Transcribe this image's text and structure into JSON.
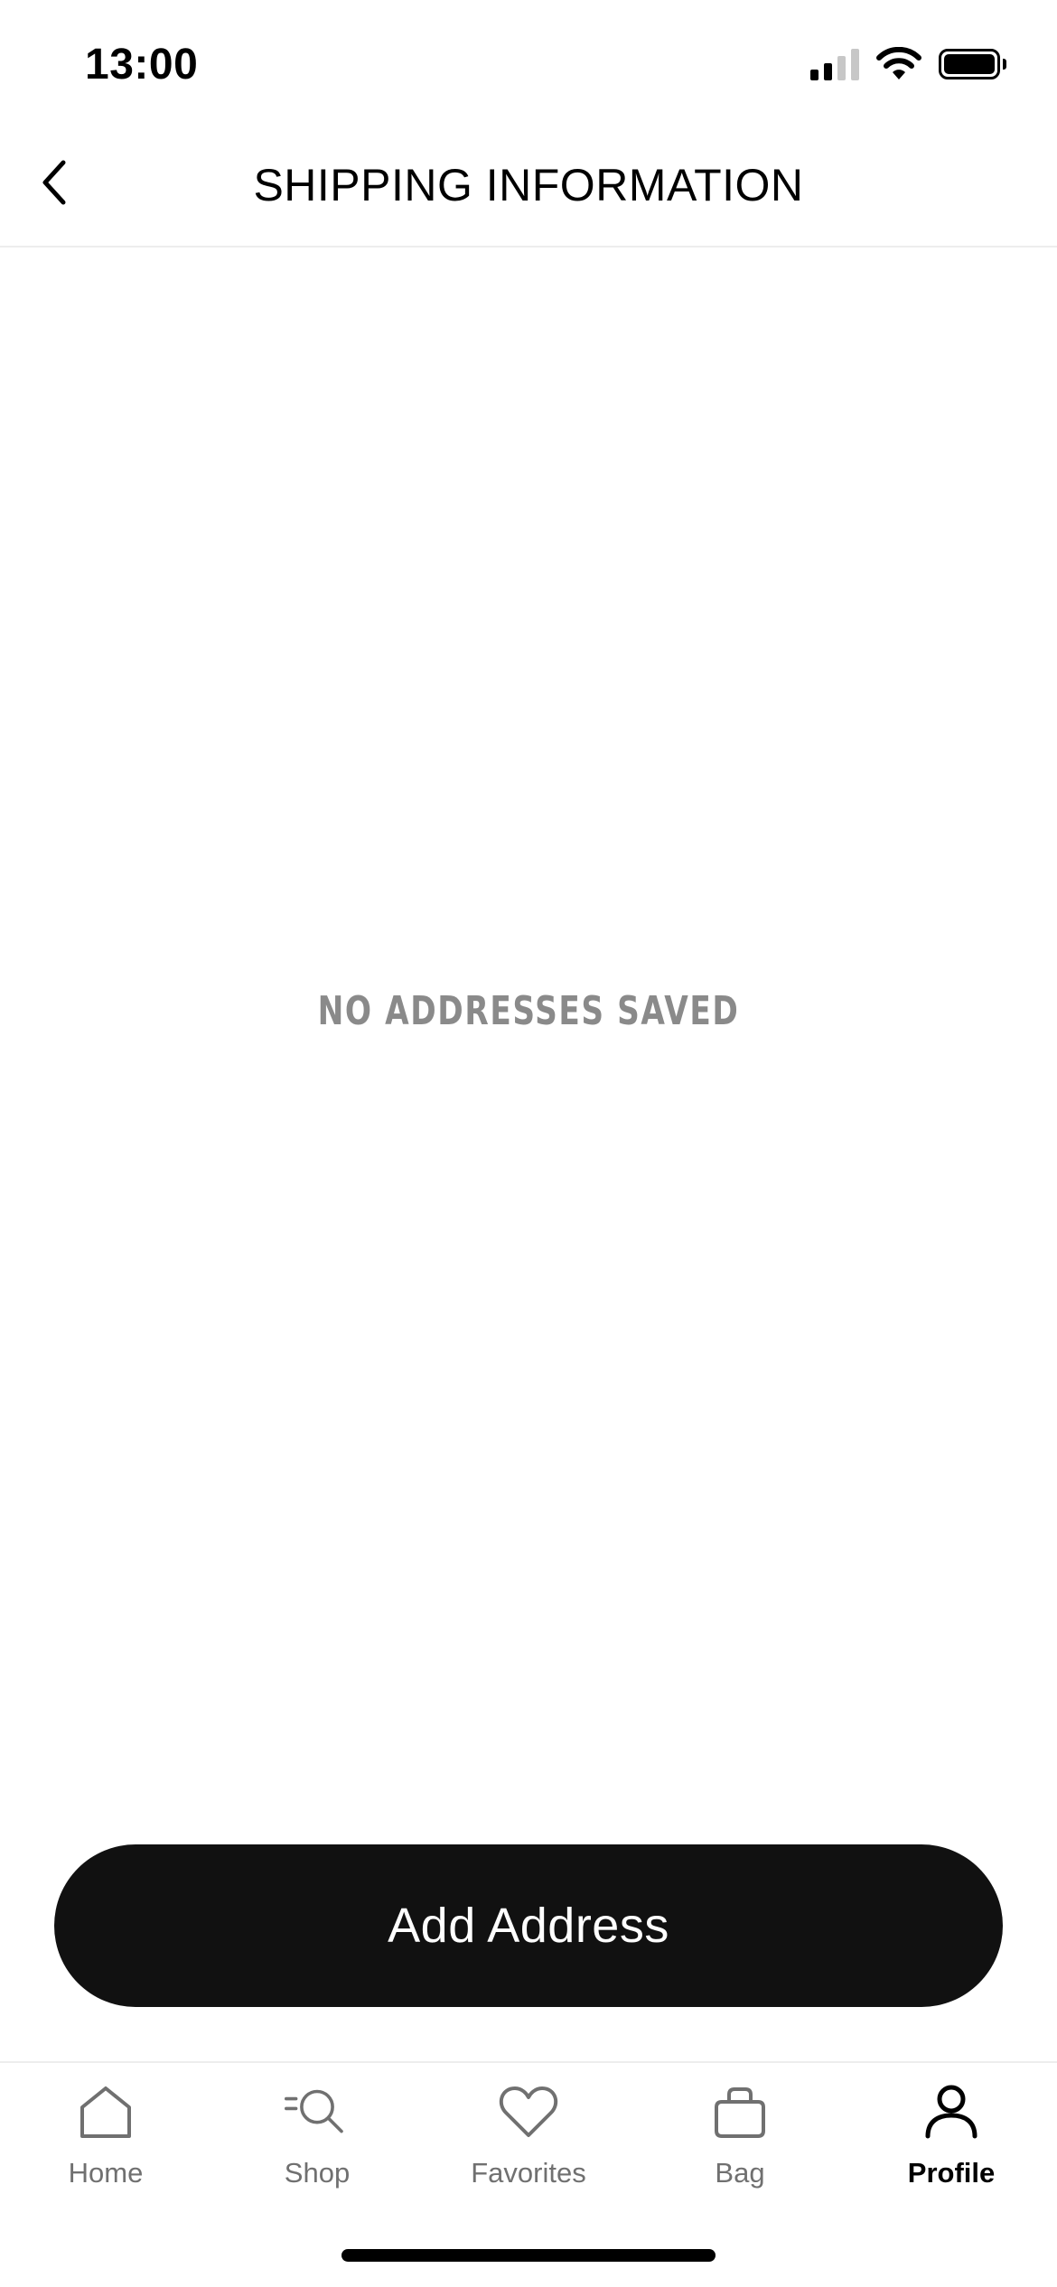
{
  "status_bar": {
    "time": "13:00",
    "icons": [
      "cellular-signal-icon",
      "wifi-icon",
      "battery-icon"
    ]
  },
  "header": {
    "back_icon": "chevron-left-icon",
    "title": "SHIPPING INFORMATION"
  },
  "main": {
    "empty_message": "NO ADDRESSES SAVED"
  },
  "actions": {
    "add_address_label": "Add Address"
  },
  "tab_bar": {
    "tabs": [
      {
        "label": "Home",
        "icon": "home-icon",
        "active": false
      },
      {
        "label": "Shop",
        "icon": "search-icon",
        "active": false
      },
      {
        "label": "Favorites",
        "icon": "heart-icon",
        "active": false
      },
      {
        "label": "Bag",
        "icon": "bag-icon",
        "active": false
      },
      {
        "label": "Profile",
        "icon": "profile-icon",
        "active": true
      }
    ]
  },
  "colors": {
    "primary": "#111111",
    "muted_text": "#8a8a8a",
    "tab_inactive": "#707070",
    "divider": "#ededed",
    "background": "#ffffff"
  }
}
